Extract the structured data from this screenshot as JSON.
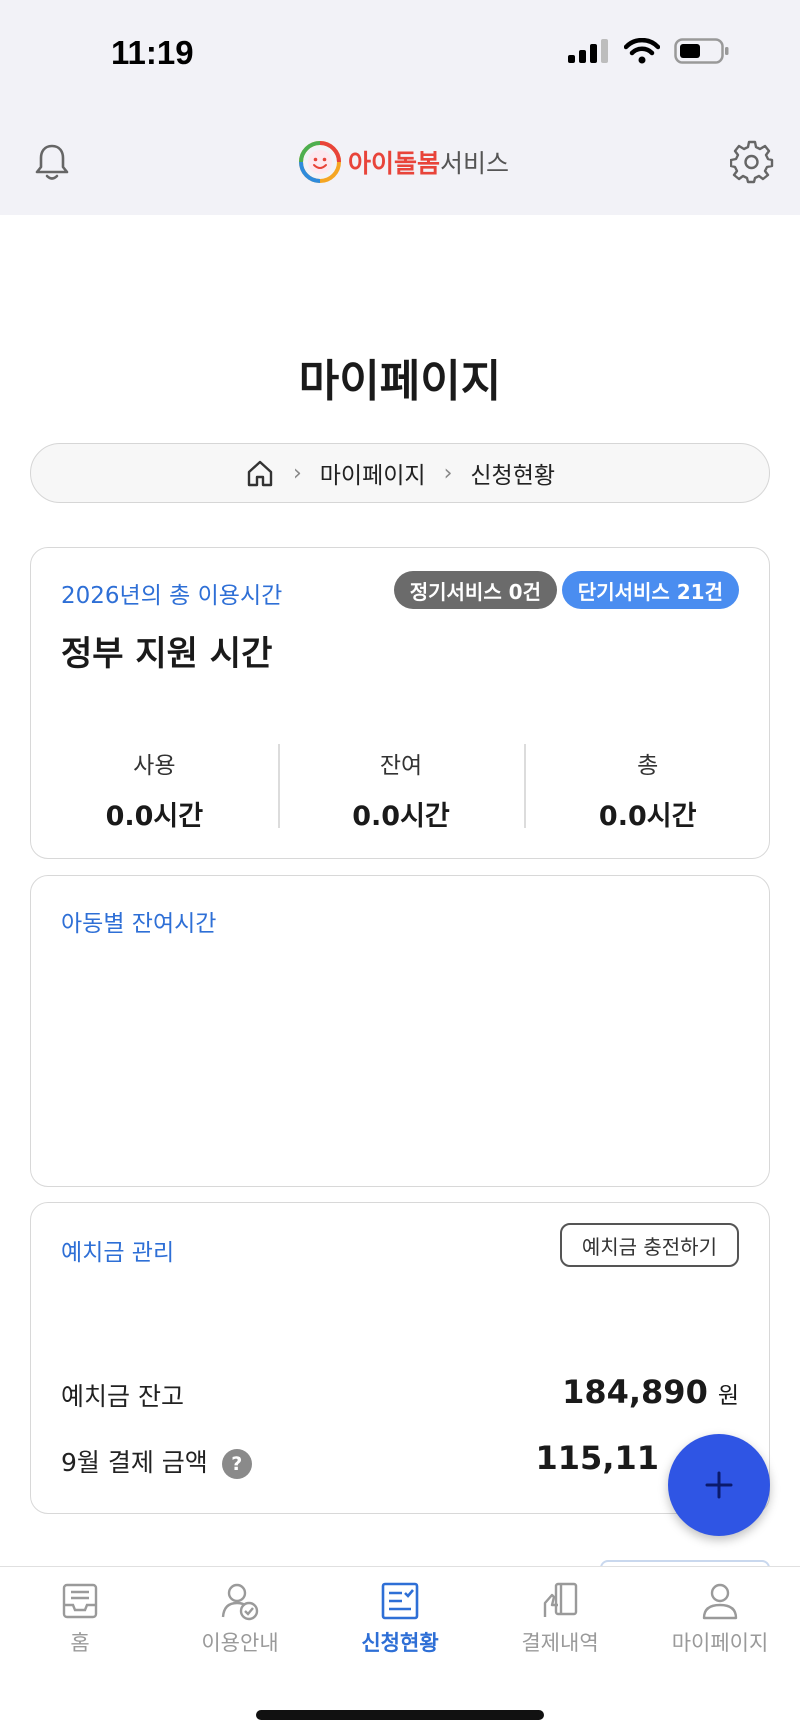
{
  "status_bar": {
    "time": "11:19"
  },
  "header": {
    "logo_brand": "아이돌봄",
    "logo_suffix": "서비스"
  },
  "page": {
    "title": "마이페이지"
  },
  "breadcrumb": {
    "items": [
      "마이페이지",
      "신청현황"
    ]
  },
  "usage_card": {
    "heading": "2026년의 총 이용시간",
    "badge_regular": "정기서비스 0건",
    "badge_short": "단기서비스 21건",
    "title": "정부 지원 시간",
    "stats": [
      {
        "label": "사용",
        "value": "0.0시간"
      },
      {
        "label": "잔여",
        "value": "0.0시간"
      },
      {
        "label": "총",
        "value": "0.0시간"
      }
    ]
  },
  "child_card": {
    "heading": "아동별 잔여시간"
  },
  "deposit_card": {
    "heading": "예치금 관리",
    "charge_button": "예치금 충전하기",
    "balance_label": "예치금 잔고",
    "balance_value": "184,890",
    "balance_unit": "원",
    "payment_label": "9월 결제 금액",
    "payment_value": "115,11"
  },
  "bottom_nav": {
    "items": [
      {
        "label": "홈"
      },
      {
        "label": "이용안내"
      },
      {
        "label": "신청현황"
      },
      {
        "label": "결제내역"
      },
      {
        "label": "마이페이지"
      }
    ],
    "active_index": 2
  },
  "colors": {
    "accent": "#2e6fd6",
    "fab": "#2f55e4",
    "badge_blue": "#4a8df0",
    "badge_gray": "#6b6b6b"
  }
}
